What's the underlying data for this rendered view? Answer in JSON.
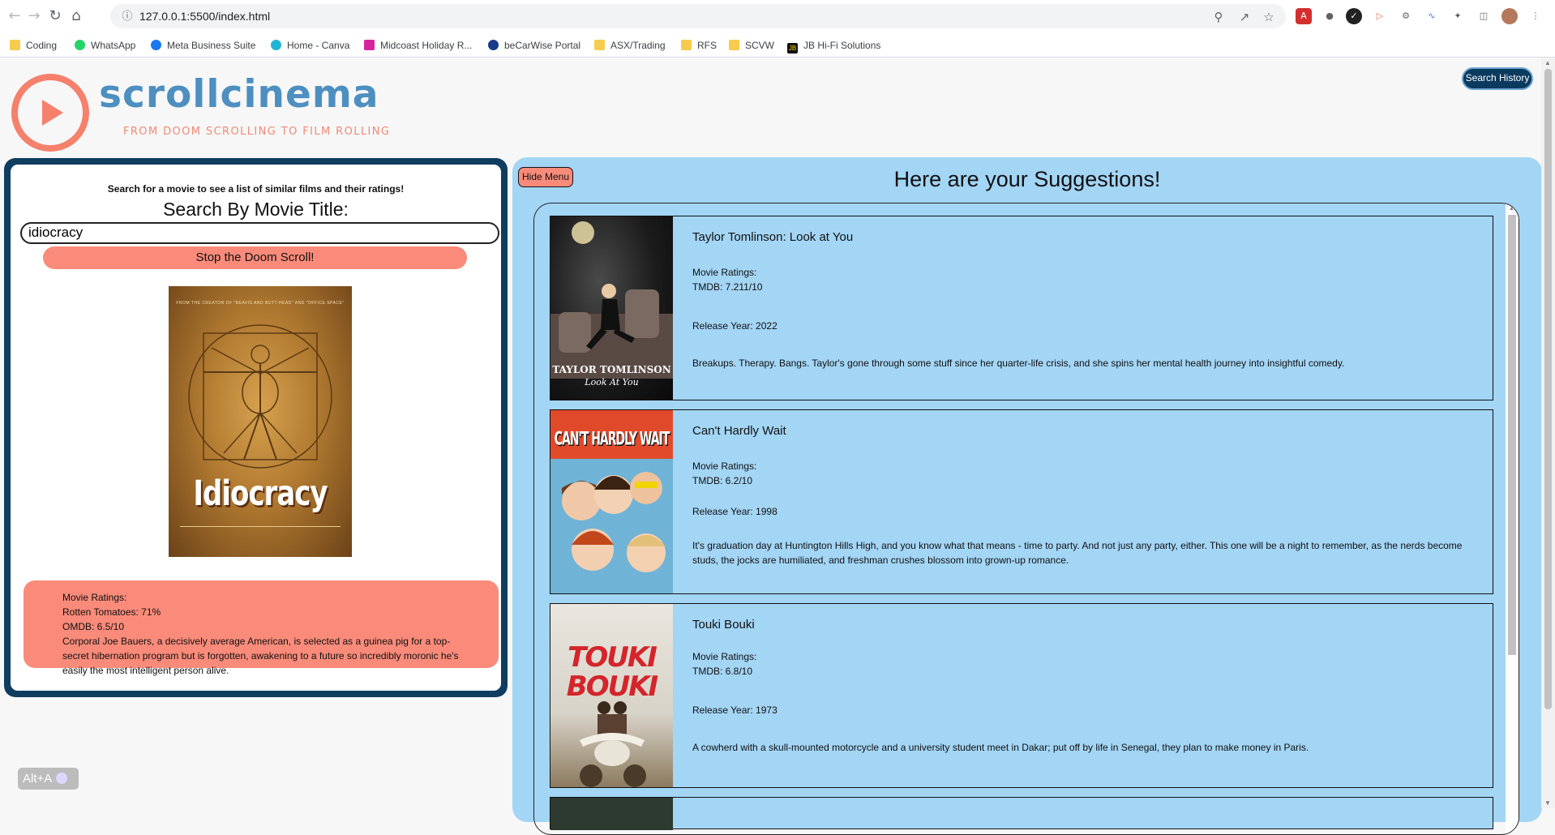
{
  "browser": {
    "url": "127.0.0.1:5500/index.html",
    "bookmarks": [
      {
        "label": "Coding"
      },
      {
        "label": "WhatsApp"
      },
      {
        "label": "Meta Business Suite"
      },
      {
        "label": "Home - Canva"
      },
      {
        "label": "Midcoast Holiday R..."
      },
      {
        "label": "beCarWise Portal"
      },
      {
        "label": "ASX/Trading"
      },
      {
        "label": "RFS"
      },
      {
        "label": "SCVW"
      },
      {
        "label": "JB Hi-Fi Solutions"
      }
    ]
  },
  "header": {
    "brand": "scrollcinema",
    "tagline": "FROM DOOM SCROLLING TO FILM ROLLING",
    "history_button": "Search History"
  },
  "search": {
    "hint": "Search for a movie to see a list of similar films and their ratings!",
    "title": "Search By Movie Title:",
    "query": "idiocracy",
    "button": "Stop the Doom Scroll!",
    "poster_title": "Idiocracy",
    "poster_tagline": "FROM THE CREATOR OF \"BEAVIS AND BUTT-HEAD\" AND \"OFFICE SPACE\"",
    "ratings_label": "Movie Ratings:",
    "rotten_tomatoes": "Rotten Tomatoes: 71%",
    "omdb": "OMDB: 6.5/10",
    "plot": "Corporal Joe Bauers, a decisively average American, is selected as a guinea pig for a top-secret hibernation program but is forgotten, awakening to a future so incredibly moronic he's easily the most intelligent person alive."
  },
  "suggestions": {
    "hide_button": "Hide Menu",
    "title": "Here are your Suggestions!",
    "items": [
      {
        "title": "Taylor Tomlinson: Look at You",
        "ratings_label": "Movie Ratings:",
        "tmdb": "TMDB: 7.211/10",
        "year": "Release Year: 2022",
        "overview": "Breakups. Therapy. Bangs. Taylor's gone through some stuff since her quarter-life crisis, and she spins her mental health journey into insightful comedy.",
        "poster_text": "TAYLOR TOMLINSON",
        "poster_sub": "Look At You"
      },
      {
        "title": "Can't Hardly Wait",
        "ratings_label": "Movie Ratings:",
        "tmdb": "TMDB: 6.2/10",
        "year": "Release Year: 1998",
        "overview": "It's graduation day at Huntington Hills High, and you know what that means - time to party. And not just any party, either. This one will be a night to remember, as the nerds become studs, the jocks are humiliated, and freshman crushes blossom into grown-up romance.",
        "poster_text": "CAN'T HARDLY WAIT"
      },
      {
        "title": "Touki Bouki",
        "ratings_label": "Movie Ratings:",
        "tmdb": "TMDB: 6.8/10",
        "year": "Release Year: 1973",
        "overview": "A cowherd with a skull-mounted motorcycle and a university student meet in Dakar; put off by life in Senegal, they plan to make money in Paris.",
        "poster_text": "TOUKI BOUKI"
      }
    ]
  },
  "overlay": {
    "shortcut": "Alt+A"
  },
  "colors": {
    "accent": "#fa8b7a",
    "navy": "#0e3d5f",
    "panel_blue": "#a3d5f5",
    "brand_blue": "#4d8fc0"
  }
}
